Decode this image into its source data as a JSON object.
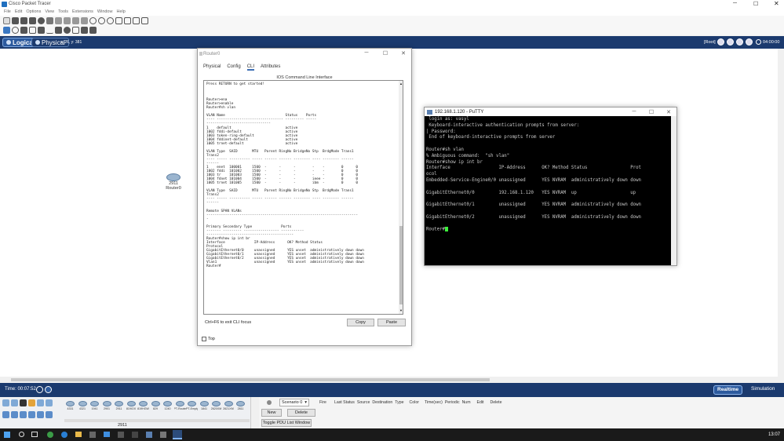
{
  "app": {
    "title": "Cisco Packet Tracer"
  },
  "menu": [
    "File",
    "Edit",
    "Options",
    "View",
    "Tools",
    "Extensions",
    "Window",
    "Help"
  ],
  "modes": {
    "logical": "Logical",
    "physical": "Physical",
    "coords": "x: 26, y: 381",
    "root": "[Root]",
    "clock": "04:00:00"
  },
  "device": {
    "model": "2911",
    "name": "Router0"
  },
  "statusbar": {
    "time": "Time: 00:07:52",
    "realtime": "Realtime",
    "simulation": "Simulation"
  },
  "device_panel": {
    "selected_model": "2911",
    "models": [
      "4331",
      "4321",
      "1941",
      "2901",
      "2911",
      "819IOX",
      "819HGW",
      "829",
      "1240",
      "PT-Router",
      "PT-Empty",
      "1841",
      "2620XM",
      "2621XM",
      "2811"
    ]
  },
  "sim_panel": {
    "scenario": "Scenario 0",
    "new_label": "New",
    "delete_label": "Delete",
    "toggle_label": "Toggle PDU List Window",
    "columns": [
      "Fire",
      "Last Status",
      "Source",
      "Destination",
      "Type",
      "Color",
      "Time(sec)",
      "Periodic",
      "Num",
      "Edit",
      "Delete"
    ]
  },
  "router_window": {
    "title": "Router0",
    "tabs": [
      "Physical",
      "Config",
      "CLI",
      "Attributes"
    ],
    "active_tab": "CLI",
    "header": "IOS Command Line Interface",
    "cli_lines": [
      "Press RETURN to get started!",
      "",
      "",
      "",
      "Router>ena",
      "Router>enable",
      "Router#sh vlan",
      "",
      "VLAN Name                             Status    Ports",
      "---- -------------------------------- --------- -----",
      "-------------------------------",
      "1    default                          active",
      "1002 fddi-default                     active",
      "1003 token-ring-default               active",
      "1004 fddinet-default                  active",
      "1005 trnet-default                    active",
      "",
      "VLAN Type  SAID       MTU   Parent RingNo BridgeNo Stp  BrdgMode Trans1",
      "Trans2",
      "---- ----- ---------- ----- ------ ------ -------- ---- -------- ------",
      "------",
      "1    enet  100001     1500  -      -      -        -    -        0      0",
      "1002 fddi  101002     1500  -      -      -        -    -        0      0",
      "1003 tr    101003     1500  -      -      -        -    -        0      0",
      "1004 fdnet 101004     1500  -      -      -        ieee -        0      0",
      "1005 trnet 101005     1500  -      -      -        ibm  -        0      0",
      "",
      "VLAN Type  SAID       MTU   Parent RingNo BridgeNo Stp  BrdgMode Trans1",
      "Trans2",
      "---- ----- ---------- ----- ------ ------ -------- ---- -------- ------",
      "------",
      "",
      "Remote SPAN VLANs",
      "-------------------------------------------------------------------------",
      "-",
      "",
      "Primary Secondary Type              Ports",
      "------- --------- ----------------- -----------",
      "------------------------------------------",
      "Router#show ip int br",
      "Interface              IP-Address      OK? Method Status",
      "Protocol",
      "GigabitEthernet0/0     unassigned      YES unset  administratively down down",
      "GigabitEthernet0/1     unassigned      YES unset  administratively down down",
      "GigabitEthernet0/2     unassigned      YES unset  administratively down down",
      "Vlan1                  unassigned      YES unset  administratively down down",
      "Router#"
    ],
    "hint": "Ctrl+F6 to exit CLI focus",
    "copy_label": "Copy",
    "paste_label": "Paste",
    "top_label": "Top"
  },
  "putty": {
    "title": "192.168.1.120 - PuTTY",
    "lines": [
      " login as: vasyl",
      " Keyboard-interactive authentication prompts from server:",
      "| Password:",
      " End of keyboard-interactive prompts from server",
      "",
      "Router#sh vlan",
      "% Ambiguous command:  \"sh vlan\"",
      "Router#show ip int br",
      "Interface                  IP-Address      OK? Method Status                Prot",
      "ocol",
      "Embedded-Service-Engine0/0 unassigned      YES NVRAM  administratively down down",
      "",
      "GigabitEthernet0/0         192.168.1.120   YES NVRAM  up                    up",
      "",
      "GigabitEthernet0/1         unassigned      YES NVRAM  administratively down down",
      "",
      "GigabitEthernet0/2         unassigned      YES NVRAM  administratively down down",
      "",
      "Router#"
    ]
  },
  "taskbar": {
    "clock": "13:07"
  }
}
